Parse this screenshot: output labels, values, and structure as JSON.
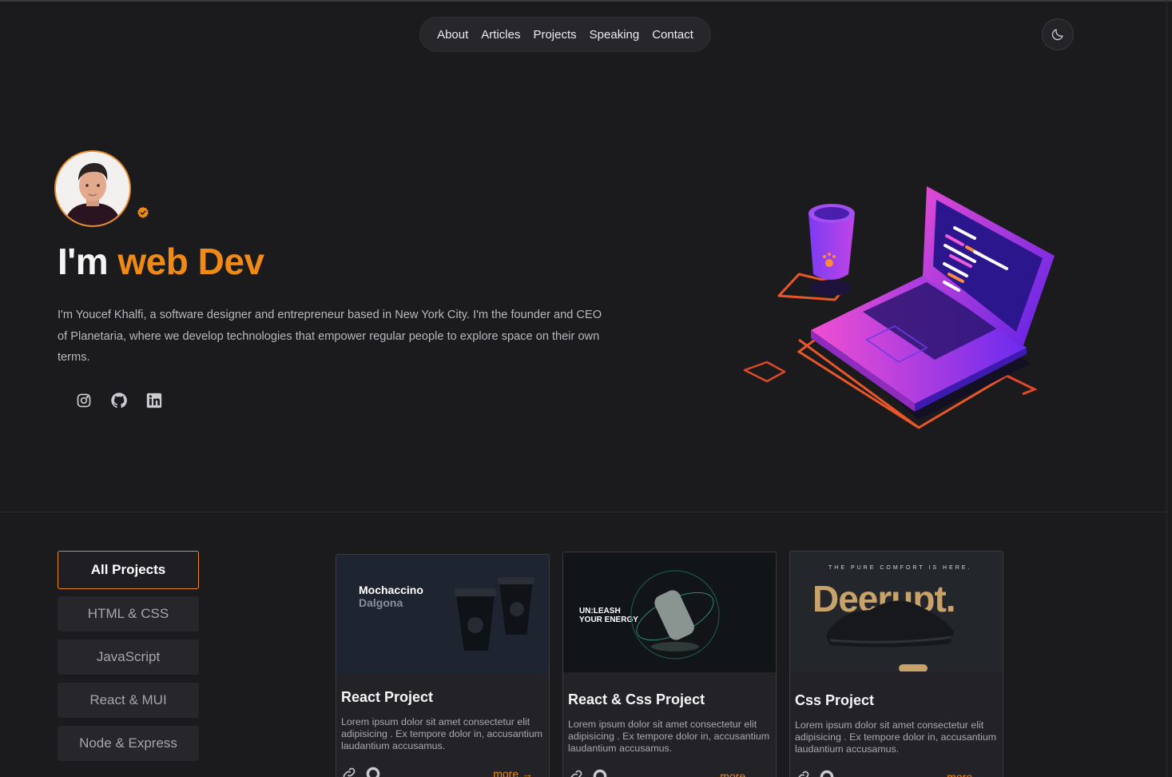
{
  "nav": {
    "items": [
      "About",
      "Articles",
      "Projects",
      "Speaking",
      "Contact"
    ]
  },
  "hero": {
    "title_prefix": "I'm",
    "title_accent": "web Dev",
    "description": "I'm Youcef Khalfi, a software designer and entrepreneur based in New York City. I'm the founder and CEO of Planetaria, where we develop technologies that empower regular people to explore space on their own terms."
  },
  "socials": [
    "instagram-icon",
    "github-icon",
    "linkedin-icon"
  ],
  "filters": [
    "All Projects",
    "HTML & CSS",
    "JavaScript",
    "React & MUI",
    "Node & Express"
  ],
  "projects": [
    {
      "title": "React Project",
      "description": "Lorem ipsum dolor sit amet consectetur elit adipisicing . Ex tempore dolor in, accusantium laudantium accusamus.",
      "more": "more",
      "thumb_heading": "Mochaccino",
      "thumb_subheading": "Dalgona"
    },
    {
      "title": "React & Css Project",
      "description": "Lorem ipsum dolor sit amet consectetur elit adipisicing . Ex tempore dolor in, accusantium laudantium accusamus.",
      "more": "more",
      "thumb_heading": "UN:LEASH",
      "thumb_subheading": "YOUR ENERGY"
    },
    {
      "title": "Css Project",
      "description": "Lorem ipsum dolor sit amet consectetur elit adipisicing . Ex tempore dolor in, accusantium laudantium accusamus.",
      "more": "more",
      "thumb_tagline": "THE PURE COMFORT IS HERE.",
      "thumb_heading": "Deerupt."
    }
  ],
  "colors": {
    "accent": "#f08a16",
    "background": "#1b1a1d",
    "surface": "#27262a"
  }
}
